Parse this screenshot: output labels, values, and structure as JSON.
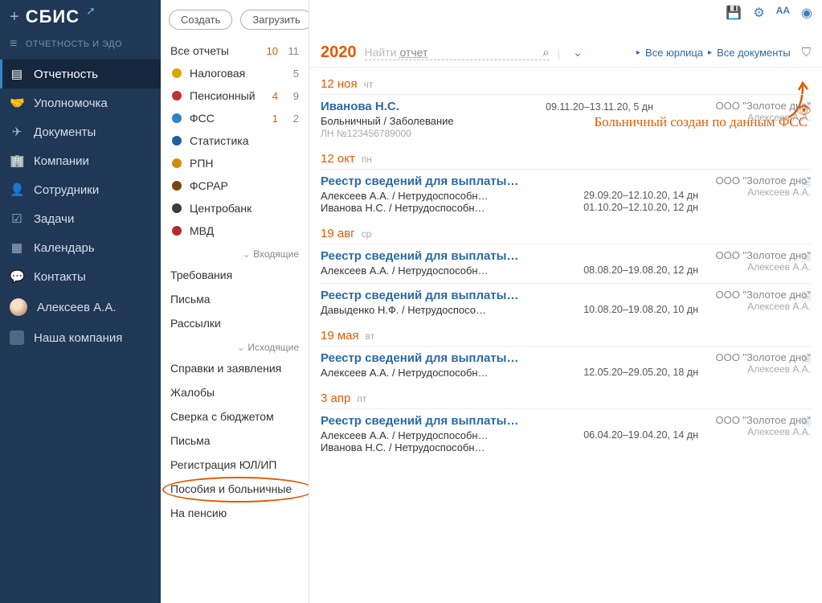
{
  "app": {
    "logo": "СБИС",
    "section": "ОТЧЕТНОСТЬ И ЭДО"
  },
  "nav": [
    {
      "icon": "report",
      "label": "Отчетность",
      "active": true
    },
    {
      "icon": "handshake",
      "label": "Уполномочка"
    },
    {
      "icon": "plane",
      "label": "Документы"
    },
    {
      "icon": "companies",
      "label": "Компании"
    },
    {
      "icon": "people",
      "label": "Сотрудники"
    },
    {
      "icon": "tasks",
      "label": "Задачи"
    },
    {
      "icon": "calendar",
      "label": "Календарь"
    },
    {
      "icon": "contacts",
      "label": "Контакты"
    }
  ],
  "user": {
    "name": "Алексеев А.А."
  },
  "our_company": {
    "label": "Наша компания"
  },
  "buttons": {
    "create": "Создать",
    "upload": "Загрузить"
  },
  "categories": {
    "all": {
      "label": "Все отчеты",
      "c1": "10",
      "c2": "11"
    },
    "items": [
      {
        "key": "tax",
        "label": "Налоговая",
        "c1": "",
        "c2": "5"
      },
      {
        "key": "pension",
        "label": "Пенсионный",
        "c1": "4",
        "c2": "9"
      },
      {
        "key": "fss",
        "label": "ФСС",
        "c1": "1",
        "c2": "2"
      },
      {
        "key": "stat",
        "label": "Статистика",
        "c1": "",
        "c2": ""
      },
      {
        "key": "rpn",
        "label": "РПН",
        "c1": "",
        "c2": ""
      },
      {
        "key": "fsrar",
        "label": "ФСРАР",
        "c1": "",
        "c2": ""
      },
      {
        "key": "cbr",
        "label": "Центробанк",
        "c1": "",
        "c2": ""
      },
      {
        "key": "mvd",
        "label": "МВД",
        "c1": "",
        "c2": ""
      }
    ],
    "incoming": "Входящие",
    "incoming_items": [
      "Требования",
      "Письма",
      "Рассылки"
    ],
    "outgoing": "Исходящие",
    "outgoing_items": [
      "Справки и заявления",
      "Жалобы",
      "Сверка с бюджетом",
      "Письма",
      "Регистрация ЮЛ/ИП",
      "Пособия и больничные",
      "На пенсию"
    ]
  },
  "toolbar": {
    "year": "2020",
    "search_prefix": "Найти",
    "search_value": "отчет",
    "bc1": "Все юрлица",
    "bc2": "Все документы"
  },
  "annotation": "Больничный создан по данным ФСС",
  "groups": [
    {
      "date": "12 ноя",
      "dow": "чт",
      "records": [
        {
          "title": "Иванова Н.С.",
          "sub": "Больничный / Заболевание",
          "meta": "ЛН №123456789000",
          "period": "09.11.20–13.11.20, 5 дн",
          "company": "ООО \"Золотое дно\"",
          "author": "Алексеев А.А.",
          "eye": true
        }
      ]
    },
    {
      "date": "12 окт",
      "dow": "пн",
      "records": [
        {
          "title": "Реестр сведений для выплаты…",
          "lines": [
            {
              "n": "Алексеев А.А. / Нетрудоспособн…",
              "d": "29.09.20–12.10.20, 14 дн"
            },
            {
              "n": "Иванова Н.С. / Нетрудоспособн…",
              "d": "01.10.20–12.10.20, 12 дн"
            }
          ],
          "company": "ООО \"Золотое дно\"",
          "author": "Алексеев А.А."
        }
      ]
    },
    {
      "date": "19 авг",
      "dow": "ср",
      "records": [
        {
          "title": "Реестр сведений для выплаты…",
          "lines": [
            {
              "n": "Алексеев А.А. / Нетрудоспособн…",
              "d": "08.08.20–19.08.20, 12 дн"
            }
          ],
          "company": "ООО \"Золотое дно\"",
          "author": "Алексеев А.А."
        },
        {
          "title": "Реестр сведений для выплаты…",
          "lines": [
            {
              "n": "Давыденко Н.Ф. / Нетрудоспосо…",
              "d": "10.08.20–19.08.20, 10 дн"
            }
          ],
          "company": "ООО \"Золотое дно\"",
          "author": "Алексеев А.А."
        }
      ]
    },
    {
      "date": "19 мая",
      "dow": "вт",
      "records": [
        {
          "title": "Реестр сведений для выплаты…",
          "lines": [
            {
              "n": "Алексеев А.А. / Нетрудоспособн…",
              "d": "12.05.20–29.05.20, 18 дн"
            }
          ],
          "company": "ООО \"Золотое дно\"",
          "author": "Алексеев А.А."
        }
      ]
    },
    {
      "date": "3 апр",
      "dow": "пт",
      "records": [
        {
          "title": "Реестр сведений для выплаты…",
          "lines": [
            {
              "n": "Алексеев А.А. / Нетрудоспособн…",
              "d": "06.04.20–19.04.20, 14 дн"
            },
            {
              "n": "Иванова Н.С. / Нетрудоспособн…",
              "d": ""
            }
          ],
          "company": "ООО \"Золотое дно\"",
          "author": "Алексеев А.А."
        }
      ]
    }
  ],
  "cat_icon_colors": {
    "tax": "#d9a705",
    "pension": "#c23434",
    "fss": "#2a81c4",
    "stat": "#1d5fa5",
    "rpn": "#d38a10",
    "fsrar": "#7a4612",
    "cbr": "#3b3b3b",
    "mvd": "#b42b2b"
  }
}
